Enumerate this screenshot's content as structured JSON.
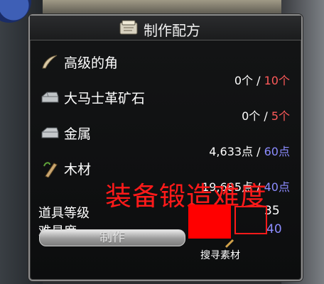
{
  "dialog": {
    "title": "制作配方"
  },
  "materials": [
    {
      "name": "高级的角",
      "have": "0个",
      "need": "10个",
      "need_color": "#ff5a5a",
      "icon": "horn-icon"
    },
    {
      "name": "大马士革矿石",
      "have": "0个",
      "need": "5个",
      "need_color": "#ff5a5a",
      "icon": "ore-icon"
    },
    {
      "name": "金属",
      "have": "4,633点",
      "need": "60点",
      "need_color": "#8c8cff",
      "icon": "metal-icon"
    },
    {
      "name": "木材",
      "have": "19,685点",
      "need": "40点",
      "need_color": "#8c8cff",
      "icon": "wood-icon"
    }
  ],
  "separator": " / ",
  "stats": {
    "item_level_label": "道具等级",
    "item_level_value": "35",
    "difficulty_label": "难易度",
    "difficulty_value": "40"
  },
  "actions": {
    "make_label": "制作",
    "search_label": "搜寻素材"
  },
  "annotation": {
    "watermark_text": "装备锻造难度"
  }
}
